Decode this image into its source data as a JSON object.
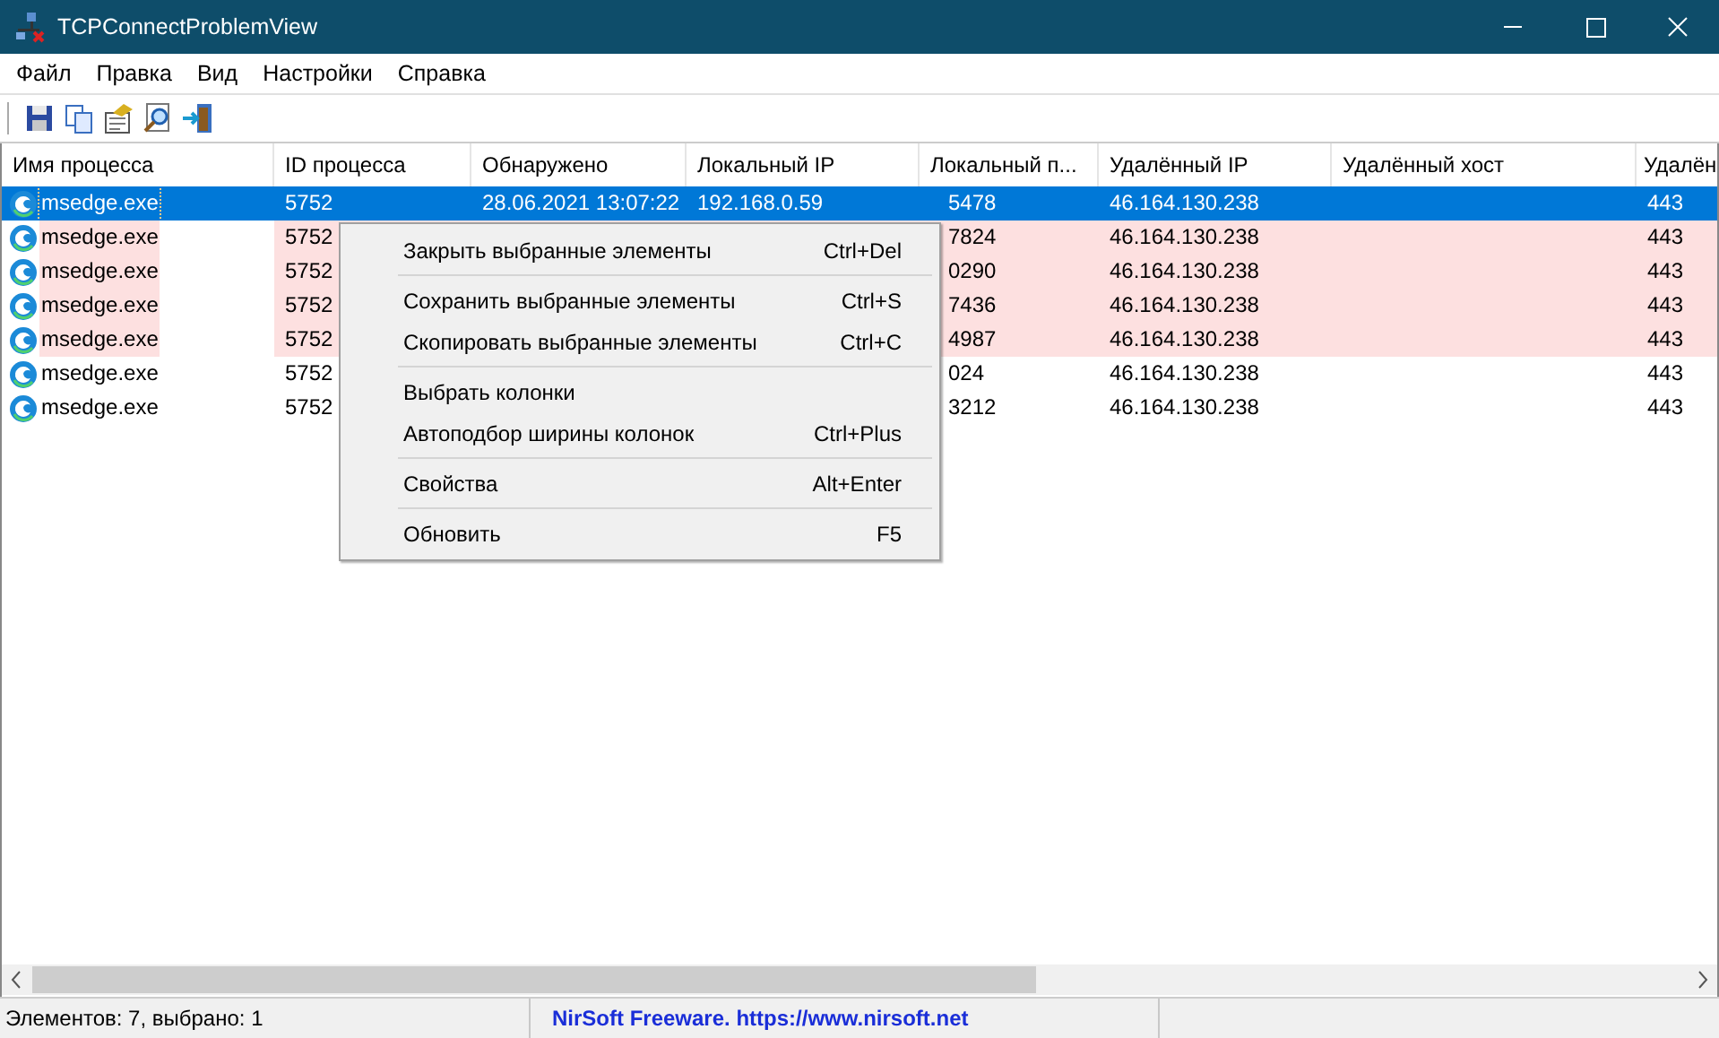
{
  "window": {
    "title": "TCPConnectProblemView"
  },
  "menu_bar": [
    "Файл",
    "Правка",
    "Вид",
    "Настройки",
    "Справка"
  ],
  "toolbar": [
    {
      "kind": "save"
    },
    {
      "kind": "copy"
    },
    {
      "kind": "properties"
    },
    {
      "kind": "find"
    },
    {
      "kind": "exit"
    }
  ],
  "table": {
    "columns": [
      "Имя процесса",
      "ID процесса",
      "Обнаружено",
      "Локальный IP",
      "Локальный п...",
      "Удалённый IP",
      "Удалённый хост",
      "Удалён"
    ],
    "rows": [
      {
        "selected": true,
        "highlighted": false,
        "cells": [
          "msedge.exe",
          "5752",
          "28.06.2021 13:07:22",
          "192.168.0.59",
          "5478",
          "46.164.130.238",
          "",
          "443"
        ]
      },
      {
        "selected": false,
        "highlighted": true,
        "cells": [
          "msedge.exe",
          "5752",
          "",
          "",
          "7824",
          "46.164.130.238",
          "",
          "443"
        ]
      },
      {
        "selected": false,
        "highlighted": true,
        "cells": [
          "msedge.exe",
          "5752",
          "",
          "",
          "0290",
          "46.164.130.238",
          "",
          "443"
        ]
      },
      {
        "selected": false,
        "highlighted": true,
        "cells": [
          "msedge.exe",
          "5752",
          "",
          "",
          "7436",
          "46.164.130.238",
          "",
          "443"
        ]
      },
      {
        "selected": false,
        "highlighted": true,
        "cells": [
          "msedge.exe",
          "5752",
          "",
          "",
          "4987",
          "46.164.130.238",
          "",
          "443"
        ]
      },
      {
        "selected": false,
        "highlighted": false,
        "cells": [
          "msedge.exe",
          "5752",
          "",
          "",
          "024",
          "46.164.130.238",
          "",
          "443"
        ]
      },
      {
        "selected": false,
        "highlighted": false,
        "cells": [
          "msedge.exe",
          "5752",
          "",
          "",
          "3212",
          "46.164.130.238",
          "",
          "443"
        ]
      }
    ]
  },
  "context_menu": [
    {
      "kind": "item",
      "label": "Закрыть выбранные элементы",
      "shortcut": "Ctrl+Del"
    },
    {
      "kind": "separator"
    },
    {
      "kind": "item",
      "label": "Сохранить выбранные элементы",
      "shortcut": "Ctrl+S"
    },
    {
      "kind": "item",
      "label": "Скопировать выбранные элементы",
      "shortcut": "Ctrl+C"
    },
    {
      "kind": "separator"
    },
    {
      "kind": "item",
      "label": "Выбрать колонки"
    },
    {
      "kind": "item",
      "label": "Автоподбор ширины колонок",
      "shortcut": "Ctrl+Plus"
    },
    {
      "kind": "separator"
    },
    {
      "kind": "item",
      "label": "Свойства",
      "shortcut": "Alt+Enter"
    },
    {
      "kind": "separator"
    },
    {
      "kind": "item",
      "label": "Обновить",
      "shortcut": "F5"
    }
  ],
  "status_bar": {
    "count": "Элементов: 7, выбрано: 1",
    "link": "NirSoft Freeware. https://www.nirsoft.net"
  }
}
